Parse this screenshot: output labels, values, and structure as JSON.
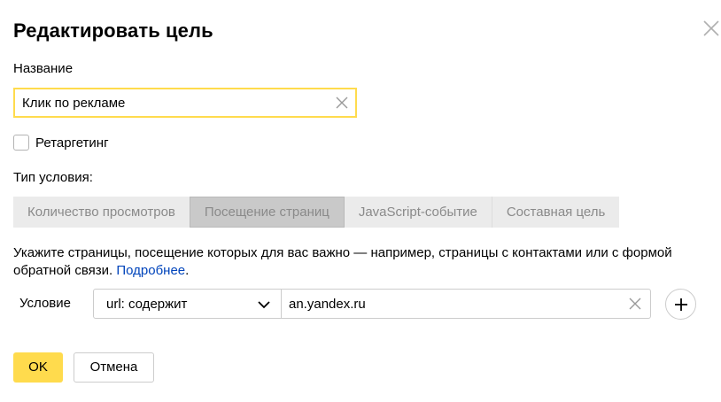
{
  "dialog": {
    "title": "Редактировать цель"
  },
  "name_field": {
    "label": "Название",
    "value": "Клик по рекламе"
  },
  "retargeting": {
    "label": "Ретаргетинг",
    "checked": false
  },
  "condition_type": {
    "label": "Тип условия:",
    "tabs": [
      {
        "label": "Количество просмотров",
        "active": false
      },
      {
        "label": "Посещение страниц",
        "active": true
      },
      {
        "label": "JavaScript-событие",
        "active": false
      },
      {
        "label": "Составная цель",
        "active": false
      }
    ]
  },
  "hint": {
    "text": "Укажите страницы, посещение которых для вас важно — например, страницы с контактами или с формой обратной связи. ",
    "link": "Подробнее",
    "suffix": "."
  },
  "condition": {
    "label": "Условие",
    "select_value": "url: содержит",
    "value": "an.yandex.ru"
  },
  "buttons": {
    "ok": "OK",
    "cancel": "Отмена"
  },
  "colors": {
    "accent": "#ffdb4d",
    "link": "#0044bb"
  },
  "icons": {
    "close": "close-icon",
    "clear": "clear-icon",
    "chevron": "chevron-down-icon",
    "add": "plus-icon"
  }
}
